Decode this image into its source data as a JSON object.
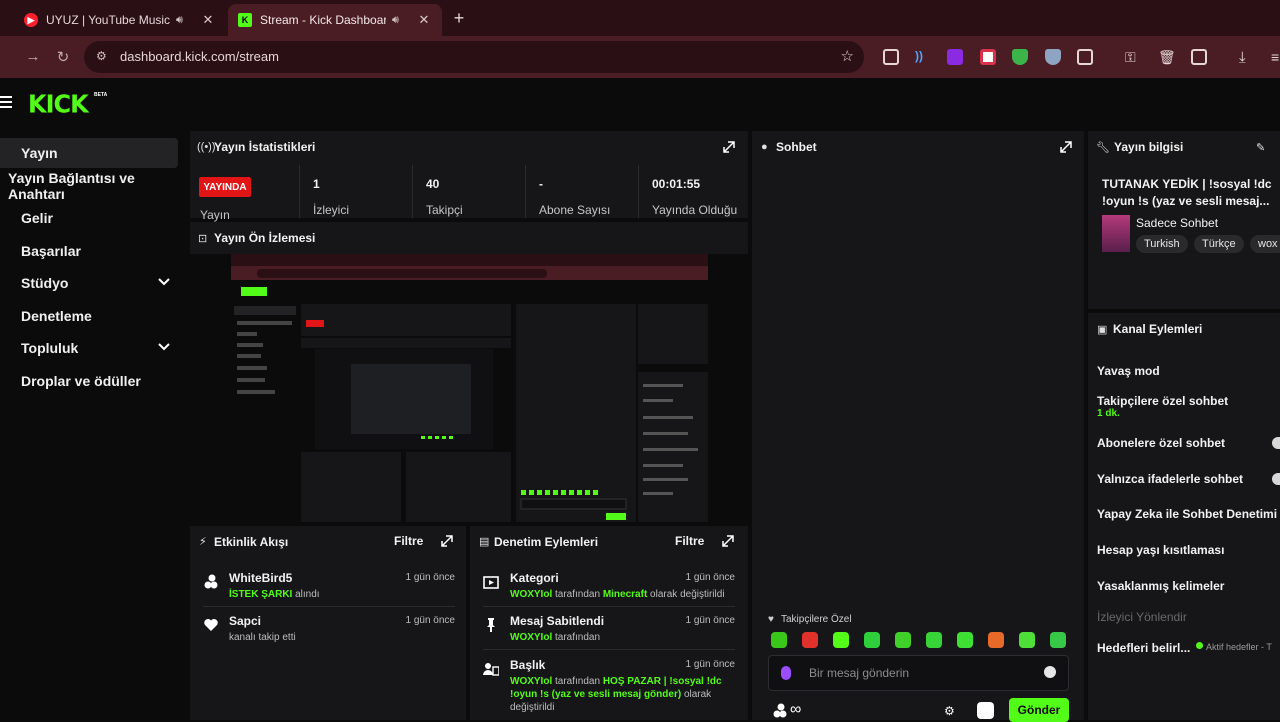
{
  "browser": {
    "tabs": [
      {
        "title": "UYUZ | YouTube Music",
        "active": false
      },
      {
        "title": "Stream - Kick Dashboard",
        "active": true
      }
    ],
    "url": "dashboard.kick.com/stream"
  },
  "app": {
    "logo": "KICK",
    "beta": "BETA"
  },
  "sidebar": {
    "items": [
      {
        "label": "Yayın",
        "active": true
      },
      {
        "label": "Yayın Bağlantısı ve Anahtarı"
      },
      {
        "label": "Gelir"
      },
      {
        "label": "Başarılar"
      },
      {
        "label": "Stüdyo",
        "expandable": true
      },
      {
        "label": "Denetleme"
      },
      {
        "label": "Topluluk",
        "expandable": true
      },
      {
        "label": "Droplar ve ödüller"
      }
    ]
  },
  "stats": {
    "title": "Yayın İstatistikleri",
    "live_badge": "YAYINDA",
    "status_label": "Yayın",
    "items": [
      {
        "value": "1",
        "label": "İzleyici"
      },
      {
        "value": "40",
        "label": "Takipçi"
      },
      {
        "value": "-",
        "label": "Abone Sayısı"
      },
      {
        "value": "00:01:55",
        "label": "Yayında Olduğu"
      }
    ]
  },
  "preview": {
    "title": "Yayın Ön İzlemesi"
  },
  "activity": {
    "title": "Etkinlik Akışı",
    "filter": "Filtre",
    "items": [
      {
        "name": "WhiteBird5",
        "highlight": "İSTEK ŞARKI",
        "text": " alındı",
        "time": "1 gün önce"
      },
      {
        "name": "Sapci",
        "highlight": "",
        "text": "kanalı takip etti",
        "time": "1 gün önce"
      }
    ]
  },
  "moderation": {
    "title": "Denetim Eylemleri",
    "filter": "Filtre",
    "items": [
      {
        "name": "Kategori",
        "user": "WOXYIol",
        "t1": " tarafından ",
        "hl": "Minecraft",
        "t2": " olarak değiştirildi",
        "time": "1 gün önce"
      },
      {
        "name": "Mesaj Sabitlendi",
        "user": "WOXYIol",
        "t1": " tarafından",
        "hl": "",
        "t2": "",
        "time": "1 gün önce"
      },
      {
        "name": "Başlık",
        "user": "WOXYIol",
        "t1": " tarafından ",
        "hl": "HOŞ PAZAR | !sosyal !dc !oyun !s (yaz ve sesli mesaj gönder)",
        "t2": " olarak değiştirildi",
        "time": "1 gün önce"
      }
    ]
  },
  "chat": {
    "title": "Sohbet",
    "followers_only": "Takipçilere Özel",
    "placeholder": "Bir mesaj gönderin",
    "infinity": "∞",
    "send": "Gönder",
    "emotes": [
      "#39c81a",
      "#e0312a",
      "#53fc18",
      "#2fcf3c",
      "#3fd12a",
      "#36d437",
      "#3ee033",
      "#e86a2a",
      "#4ee038",
      "#38c848"
    ]
  },
  "stream_info": {
    "title": "Yayın bilgisi",
    "stream_title": "TUTANAK YEDİK | !sosyal !dc !oyun !s (yaz ve sesli mesaj...",
    "category": "Sadece Sohbet",
    "tags": [
      "Turkish",
      "Türkçe",
      "wox"
    ]
  },
  "channel_actions": {
    "title": "Kanal Eylemleri",
    "items": [
      {
        "label": "Yavaş mod"
      },
      {
        "label": "Takipçilere özel sohbet",
        "sub": "1 dk."
      },
      {
        "label": "Abonelere özel sohbet",
        "toggle": true
      },
      {
        "label": "Yalnızca ifadelerle sohbet",
        "toggle": true
      },
      {
        "label": "Yapay Zeka ile Sohbet Denetimi"
      },
      {
        "label": "Hesap yaşı kısıtlaması"
      },
      {
        "label": "Yasaklanmış kelimeler"
      },
      {
        "label": "İzleyici Yönlendir",
        "disabled": true
      },
      {
        "label": "Hedefleri belirl...",
        "extra": "Aktif hedefler - T"
      }
    ]
  },
  "colors": {
    "accent": "#53fc18",
    "live": "#e11515"
  }
}
